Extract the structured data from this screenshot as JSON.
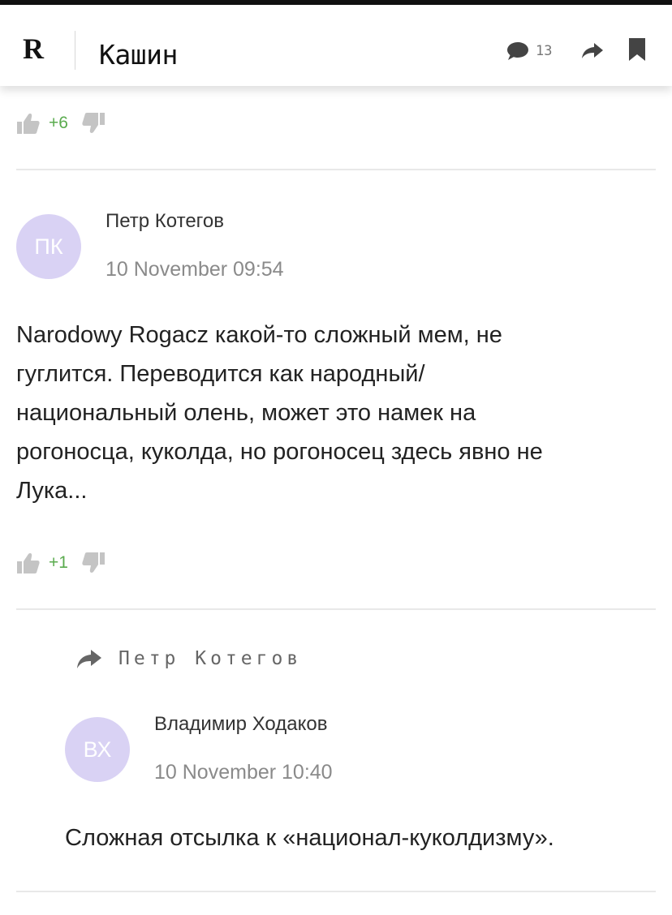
{
  "header": {
    "logo": "R",
    "title": "Кашин",
    "comment_count": "13",
    "icons": {
      "comments": "speech-bubble-icon",
      "share": "share-arrow-icon",
      "bookmark": "bookmark-icon"
    }
  },
  "prev_comment": {
    "score": "+6"
  },
  "comments": [
    {
      "initials": "ПК",
      "author": "Петр Котегов",
      "date": "10 November 09:54",
      "text_lines": [
        "Narodowy Rogacz какой-то сложный мем, не",
        "гуглится. Переводится как народный/",
        "национальный олень, может это намек на",
        "рогоносца, куколда, но рогоносец здесь явно не",
        "Лука..."
      ],
      "score": "+1"
    }
  ],
  "reply": {
    "reply_to": "Петр Котегов",
    "initials": "ВХ",
    "author": "Владимир Ходаков",
    "date": "10 November 10:40",
    "text": "Сложная отсылка к «национал-куколдизму»."
  },
  "colors": {
    "accent_green": "#5aab4e",
    "avatar_bg": "#d9d2f4",
    "text_gray": "#8a8a8a"
  }
}
